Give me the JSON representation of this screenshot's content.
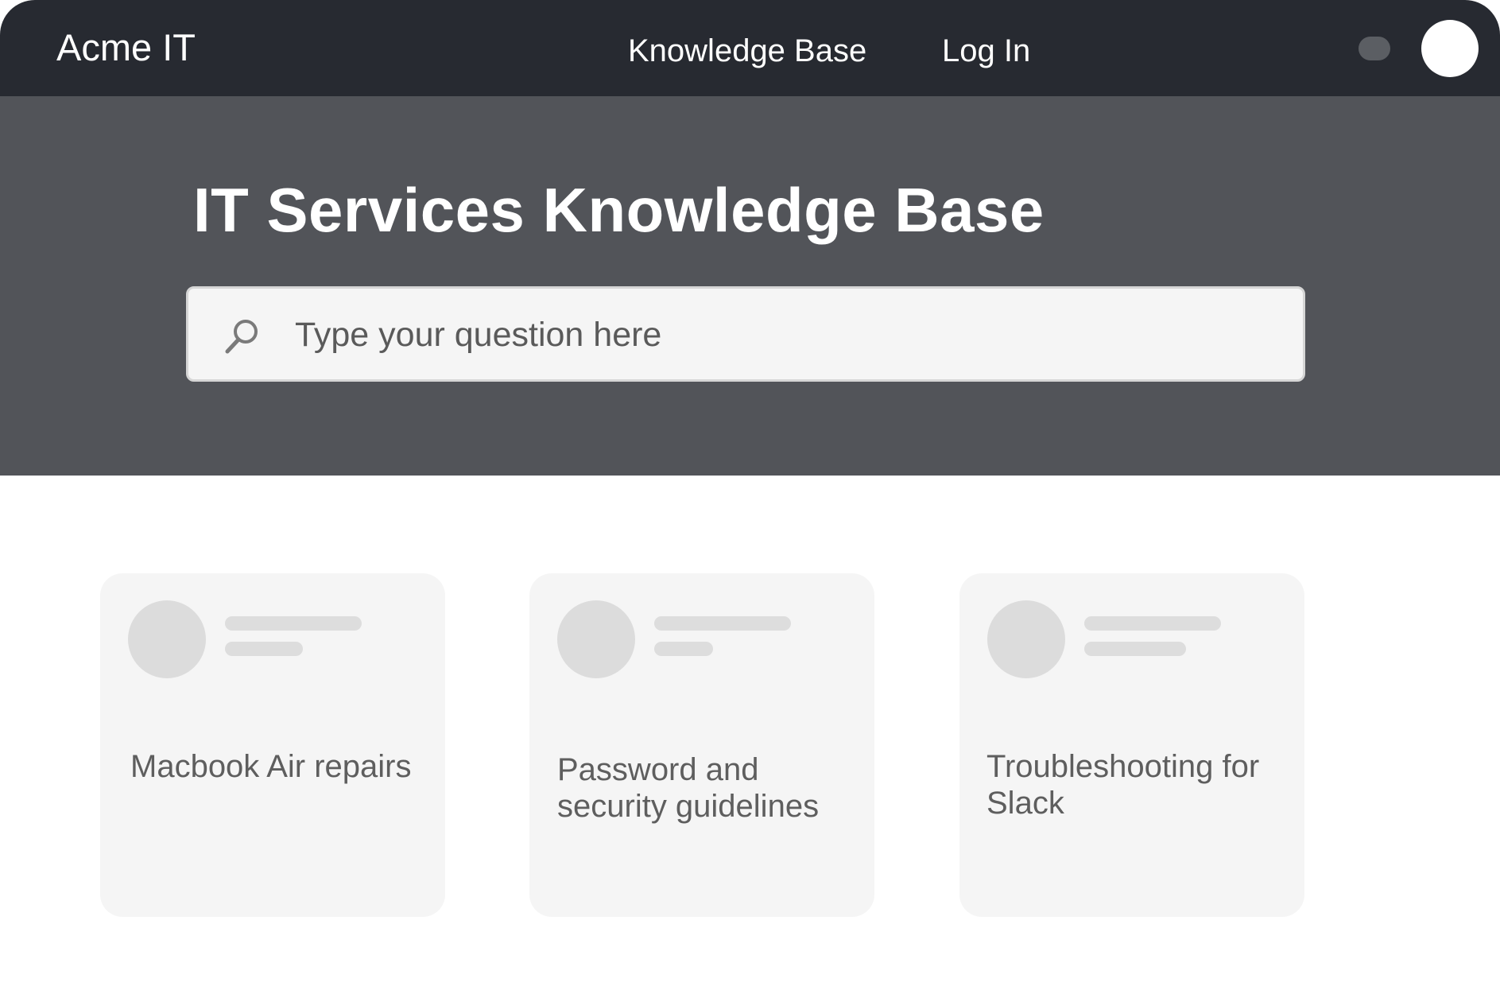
{
  "header": {
    "brand": "Acme IT",
    "nav": [
      {
        "label": "Knowledge Base"
      },
      {
        "label": "Log In"
      }
    ]
  },
  "hero": {
    "title": "IT Services Knowledge Base",
    "search": {
      "placeholder": "Type your question here",
      "icon": "search-icon"
    }
  },
  "cards": [
    {
      "title": "Macbook Air repairs"
    },
    {
      "title": "Password and security guidelines"
    },
    {
      "title": "Troubleshooting for Slack"
    }
  ],
  "colors": {
    "topbar": "#272a31",
    "hero": "#525459",
    "card": "#f5f5f5",
    "placeholder_shape": "#dcdcdc"
  }
}
